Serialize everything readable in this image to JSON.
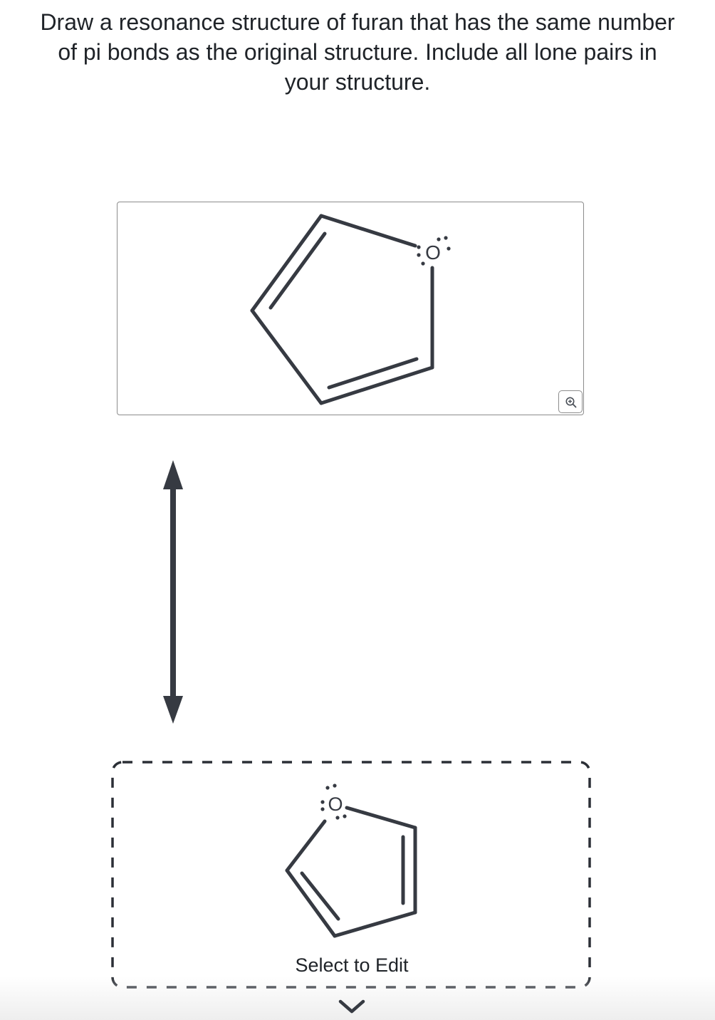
{
  "question": {
    "line1": "Draw a resonance structure of furan that has the same number",
    "line2": "of pi bonds as the original structure. Include all lone pairs in",
    "line3": "your structure."
  },
  "given_structure": {
    "oxygen_label": "O",
    "zoom_icon": "zoom-in-icon"
  },
  "resonance_arrow": {
    "icon": "double-headed-arrow-icon"
  },
  "answer_box": {
    "oxygen_label": "O",
    "edit_label": "Select to Edit",
    "expand_icon": "chevron-down-icon"
  },
  "colors": {
    "bond": "#363a42",
    "border": "#8c8c8c",
    "text": "#1f2328"
  }
}
